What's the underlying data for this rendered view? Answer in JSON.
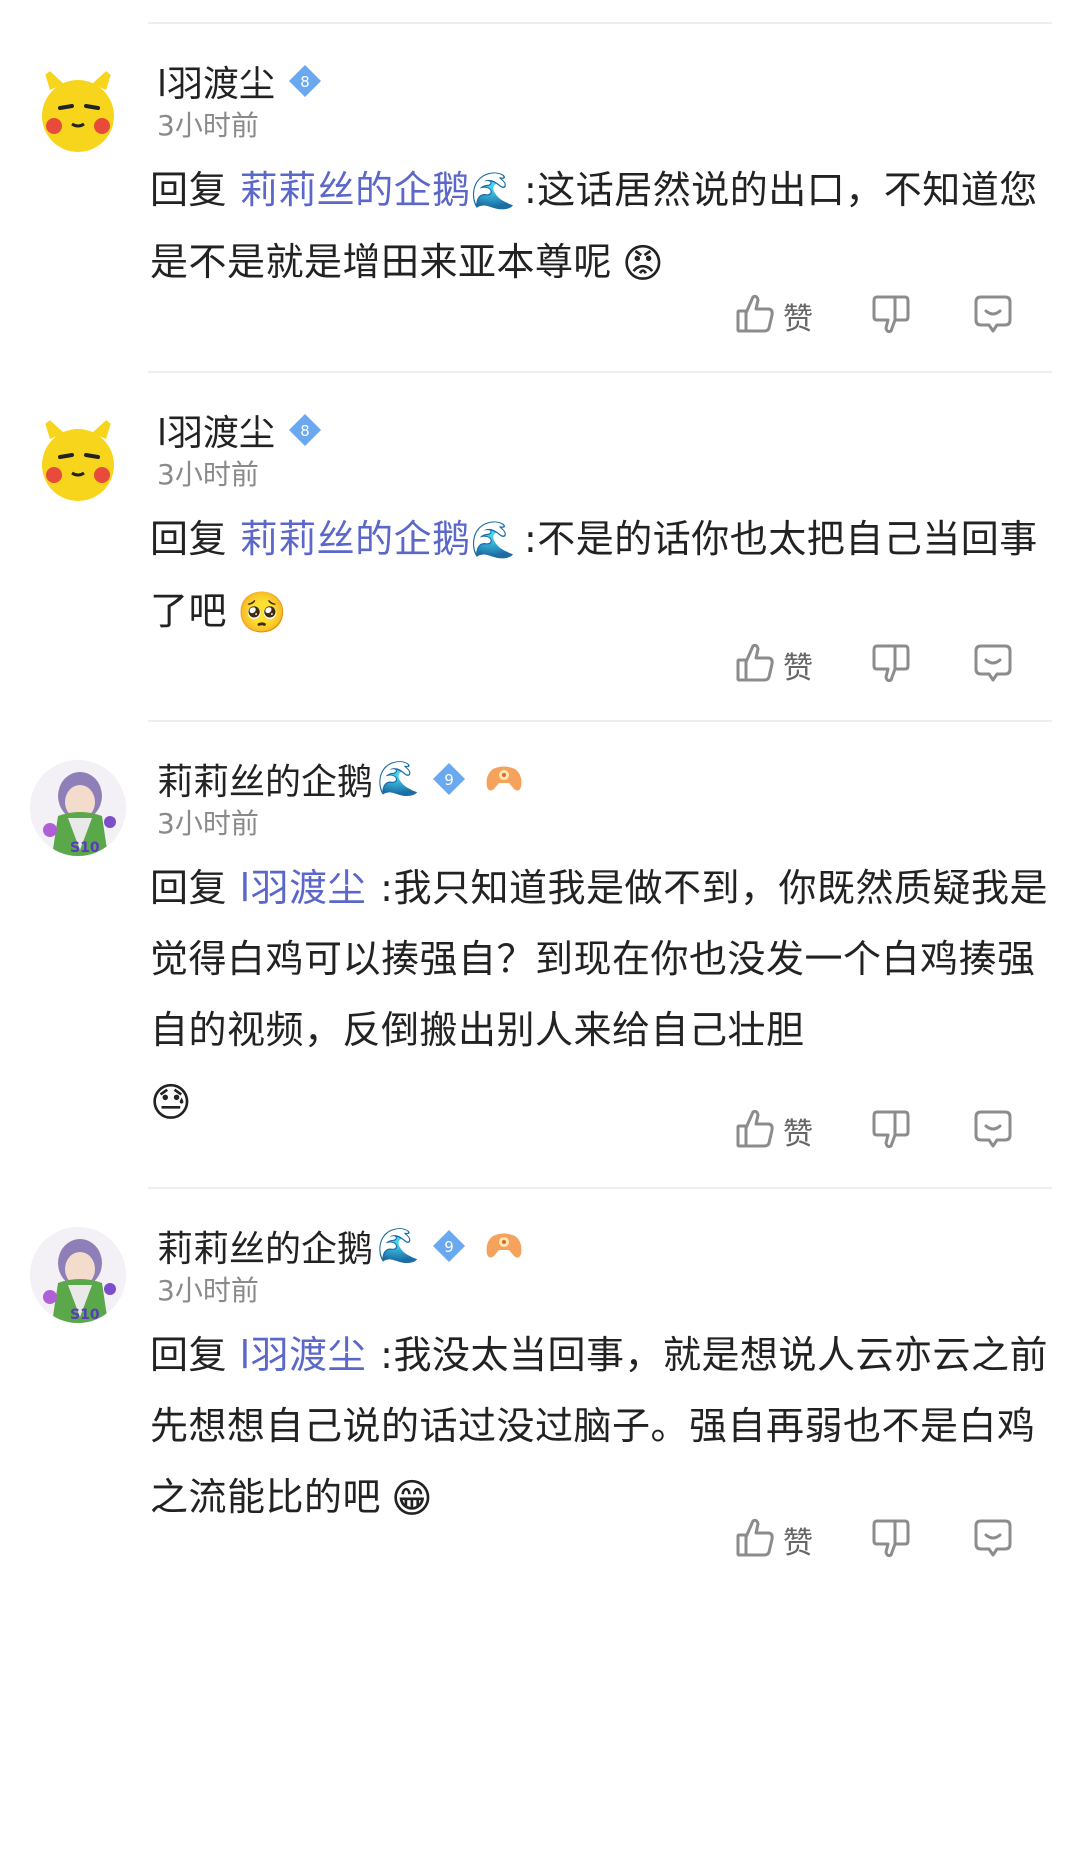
{
  "comments": [
    {
      "username": "l羽渡尘",
      "level": "8",
      "time": "3小时前",
      "reply_label": "回复",
      "reply_to": "莉莉丝的企鹅",
      "reply_to_emoji": "🌊",
      "text": ":这话居然说的出口，不知道您是不是就是增田来亚本尊呢",
      "emoji": "😡",
      "like_label": "赞"
    },
    {
      "username": "l羽渡尘",
      "level": "8",
      "time": "3小时前",
      "reply_label": "回复",
      "reply_to": "莉莉丝的企鹅",
      "reply_to_emoji": "🌊",
      "text": ":不是的话你也太把自己当回事了吧",
      "emoji": "🥺",
      "like_label": "赞"
    },
    {
      "username": "莉莉丝的企鹅",
      "username_emoji": "🌊",
      "level": "9",
      "time": "3小时前",
      "reply_label": "回复",
      "reply_to": "l羽渡尘",
      "text": ":我只知道我是做不到，你既然质疑我是觉得白鸡可以揍强自？到现在你也没发一个白鸡揍强自的视频，反倒搬出别人来给自己壮胆",
      "emoji": "😓",
      "like_label": "赞"
    },
    {
      "username": "莉莉丝的企鹅",
      "username_emoji": "🌊",
      "level": "9",
      "time": "3小时前",
      "reply_label": "回复",
      "reply_to": "l羽渡尘",
      "text": ":我没太当回事，就是想说人云亦云之前先想想自己说的话过没过脑子。强自再弱也不是白鸡之流能比的吧",
      "emoji": "😁",
      "like_label": "赞"
    }
  ],
  "colors": {
    "mention": "#5b67c9",
    "badge": "#6aa8f0",
    "time": "#8a8a8a",
    "icon": "#8c8c8c"
  },
  "icons": [
    "thumbs-up-icon",
    "thumbs-down-icon",
    "reply-bubble-icon",
    "level-diamond-icon",
    "gamepad-badge-icon"
  ]
}
